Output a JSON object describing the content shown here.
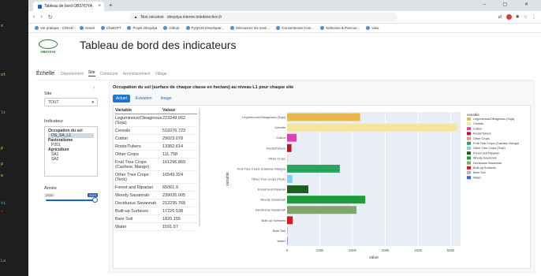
{
  "browser": {
    "tab_title": "Tableau de bord OBSYDYA",
    "new_tab": "+",
    "url_warning": "Non sécurisé",
    "url": "obsydya.interne.teledetection.fr",
    "bookmarks": [
      "Vie pratique - CIRAD",
      "Gmail",
      "ChatGPT",
      "Projet Obsydya",
      "Github",
      "PyQGIS Developer...",
      "Découvrez les envir...",
      "Conventional Com...",
      "Sélection & Parcour...",
      "view"
    ]
  },
  "app": {
    "logo_text": "OBSYDYA",
    "title": "Tableau de bord des indicateurs",
    "nav": {
      "lead": "Échelle",
      "items": [
        "Département",
        "Site",
        "Commune",
        "Arrondissement",
        "Village"
      ],
      "active": "Site"
    }
  },
  "sidebar": {
    "collapse_icon": "‹",
    "site_label": "Site",
    "site_value": "TOUT",
    "indicator_label": "Indicateur",
    "indicators": [
      {
        "text": "Occupation du sol",
        "type": "group"
      },
      {
        "text": "OS_SA_L1",
        "type": "item",
        "selected": true
      },
      {
        "text": "Pastoralisme",
        "type": "group"
      },
      {
        "text": "P201",
        "type": "item"
      },
      {
        "text": "Agriculture",
        "type": "group"
      },
      {
        "text": "SA1",
        "type": "item"
      },
      {
        "text": "SA2",
        "type": "item"
      }
    ],
    "year_label": "Année",
    "year_min": "2000",
    "year_max": "2023",
    "year_value_fraction": 1.0
  },
  "main": {
    "title": "Occupation du sol (surface de chaque classe en hectare) au niveau L1 pour chaque site",
    "tabs": [
      "Actuel",
      "Evolution",
      "Image"
    ],
    "active_tab": "Actuel",
    "table": {
      "headers": [
        "Variable",
        "Valeur"
      ],
      "rows": [
        [
          "Leguminous/Oleaginous (Soja)",
          "223349.062"
        ],
        [
          "Cereals",
          "519276.723"
        ],
        [
          "Cotton",
          "29023.078"
        ],
        [
          "Roots/Tubers",
          "13382.614"
        ],
        [
          "Other Crops",
          "111.758"
        ],
        [
          "Fruit Tree Crops (Cashew, Mango)",
          "161296.869"
        ],
        [
          "Other Tree Crops (Teck)",
          "16549.324"
        ],
        [
          "Forest and Riparian",
          "65061.9"
        ],
        [
          "Woody Savannah",
          "239035.005"
        ],
        [
          "Deciduous Savannah",
          "212235.768"
        ],
        [
          "Built-up Surfaces",
          "17226.538"
        ],
        [
          "Bare Soil",
          "1820.155"
        ],
        [
          "Water",
          "1591.57"
        ]
      ]
    }
  },
  "chart_data": {
    "type": "bar",
    "orientation": "horizontal",
    "categories": [
      "Leguminous/Oleaginous (Soja)",
      "Cereals",
      "Cotton",
      "Roots/Tubers",
      "Other Crops",
      "Fruit Tree Crops (Cashew, Mango)",
      "Other Tree Crops (Teck)",
      "Forest and Riparian",
      "Woody Savannah",
      "Deciduous Savannah",
      "Built-up Surfaces",
      "Bare Soil",
      "Water"
    ],
    "values": [
      223349.062,
      519276.723,
      29023.078,
      13382.614,
      111.758,
      161296.869,
      16549.324,
      65061.9,
      239035.005,
      212235.768,
      17226.538,
      1820.155,
      1591.57
    ],
    "colors": [
      "#e8b84a",
      "#f3e7a0",
      "#e040b0",
      "#b2182b",
      "#f08ca0",
      "#2ca25f",
      "#7fd3e8",
      "#1a5e20",
      "#1b9e3a",
      "#7fa66b",
      "#d7191c",
      "#c8a2c8",
      "#2b6fd6"
    ],
    "xlabel": "value",
    "ylabel": "variable",
    "xticks": [
      0,
      100000,
      200000,
      300000,
      400000,
      500000
    ],
    "xtick_labels": [
      "0",
      "100k",
      "200k",
      "300k",
      "400k",
      "500k"
    ],
    "xlim": [
      0,
      530000
    ],
    "legend_title": "variable",
    "legend_position": "right",
    "grid": true
  }
}
